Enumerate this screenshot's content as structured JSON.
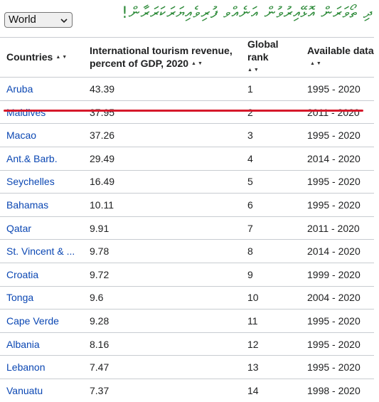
{
  "region_select": {
    "value": "World"
  },
  "banner_text": "ދި ތޯވަރަން އޮޅޭއިރުވުން އަނެއްވ ފުރިވެއިޔަރަކަރަރާން!",
  "table": {
    "headers": {
      "country": "Countries",
      "revenue": "International tourism revenue, percent of GDP, 2020",
      "rank": "Global rank",
      "available": "Available data"
    },
    "sort_glyph": "▲▼",
    "rows": [
      {
        "country": "Aruba",
        "revenue": "43.39",
        "rank": "1",
        "available": "1995 - 2020"
      },
      {
        "country": "Maldives",
        "revenue": "37.95",
        "rank": "2",
        "available": "2011 - 2020"
      },
      {
        "country": "Macao",
        "revenue": "37.26",
        "rank": "3",
        "available": "1995 - 2020"
      },
      {
        "country": "Ant.& Barb.",
        "revenue": "29.49",
        "rank": "4",
        "available": "2014 - 2020"
      },
      {
        "country": "Seychelles",
        "revenue": "16.49",
        "rank": "5",
        "available": "1995 - 2020"
      },
      {
        "country": "Bahamas",
        "revenue": "10.11",
        "rank": "6",
        "available": "1995 - 2020"
      },
      {
        "country": "Qatar",
        "revenue": "9.91",
        "rank": "7",
        "available": "2011 - 2020"
      },
      {
        "country": "St. Vincent & ...",
        "revenue": "9.78",
        "rank": "8",
        "available": "2014 - 2020"
      },
      {
        "country": "Croatia",
        "revenue": "9.72",
        "rank": "9",
        "available": "1999 - 2020"
      },
      {
        "country": "Tonga",
        "revenue": "9.6",
        "rank": "10",
        "available": "2004 - 2020"
      },
      {
        "country": "Cape Verde",
        "revenue": "9.28",
        "rank": "11",
        "available": "1995 - 2020"
      },
      {
        "country": "Albania",
        "revenue": "8.16",
        "rank": "12",
        "available": "1995 - 2020"
      },
      {
        "country": "Lebanon",
        "revenue": "7.47",
        "rank": "13",
        "available": "1995 - 2020"
      },
      {
        "country": "Vanuatu",
        "revenue": "7.37",
        "rank": "14",
        "available": "1998 - 2020"
      }
    ]
  },
  "colors": {
    "link": "#0b47b3",
    "highlight_underline": "#d6192b",
    "banner": "#2e8b3a"
  }
}
